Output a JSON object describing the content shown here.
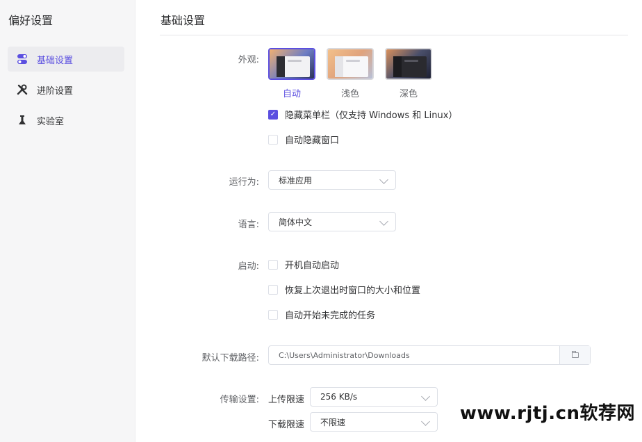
{
  "app": {
    "title": "偏好设置"
  },
  "sidebar": {
    "items": [
      {
        "label": "基础设置",
        "icon": "toggle-icon",
        "active": true
      },
      {
        "label": "进阶设置",
        "icon": "tools-icon",
        "active": false
      },
      {
        "label": "实验室",
        "icon": "flask-icon",
        "active": false
      }
    ]
  },
  "page": {
    "title": "基础设置"
  },
  "appearance": {
    "label": "外观:",
    "themes": [
      {
        "label": "自动",
        "selected": true
      },
      {
        "label": "浅色",
        "selected": false
      },
      {
        "label": "深色",
        "selected": false
      }
    ],
    "hide_menu_bar": {
      "label": "隐藏菜单栏（仅支持 Windows 和 Linux）",
      "checked": true
    },
    "auto_hide_window": {
      "label": "自动隐藏窗口",
      "checked": false
    }
  },
  "run_as": {
    "label": "运行为:",
    "value": "标准应用"
  },
  "language": {
    "label": "语言:",
    "value": "简体中文"
  },
  "startup": {
    "label": "启动:",
    "options": [
      {
        "label": "开机自动启动",
        "checked": false
      },
      {
        "label": "恢复上次退出时窗口的大小和位置",
        "checked": false
      },
      {
        "label": "自动开始未完成的任务",
        "checked": false
      }
    ]
  },
  "download_path": {
    "label": "默认下载路径:",
    "value": "C:\\Users\\Administrator\\Downloads"
  },
  "transfer": {
    "label": "传输设置:",
    "upload_label": "上传限速",
    "upload_value": "256 KB/s",
    "download_label": "下载限速",
    "download_value": "不限速"
  },
  "watermark": "www.rjtj.cn软荐网",
  "colors": {
    "accent": "#5b4fe0",
    "sidebar_bg": "#f6f6f7",
    "border": "#dcdfe6"
  }
}
